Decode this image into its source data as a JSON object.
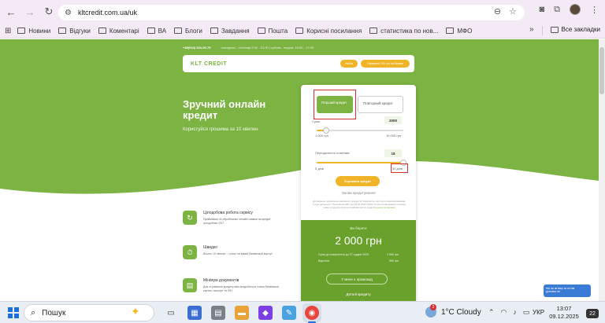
{
  "browser": {
    "url": "kltcredit.com.ua/uk",
    "nav_back": "←",
    "nav_forward": "→",
    "nav_reload": "↻",
    "zoom_icon": "⊖",
    "star_icon": "☆"
  },
  "bookmarks": {
    "apps_label": "⊞",
    "items": [
      "Новини",
      "Відгуки",
      "Коментарі",
      "ВА",
      "Блоги",
      "Завдання",
      "Пошта",
      "Корисні посилання",
      "статистика по нов...",
      "МФО"
    ],
    "more": "»",
    "all_bookmarks": "Все закладки"
  },
  "site": {
    "phone": "+38(044) 334-90-75",
    "hours": "понеділок - п'ятниця 9:00 - 21:00 | субота - неділя: 10:00 - 17:00",
    "logo": "KLT CREDIT",
    "btn_login": "Увійти",
    "btn_get": "Отримати 100 грн на баланс",
    "headline": "Зручний онлайн кредит",
    "subheadline": "Користуйся грошима за 10 хвилин",
    "features": [
      {
        "title": "Цілодобова робота сервісу",
        "text": "Приймаємо та обробляємо онлайн-заявки на кредит цілодобово 24/7",
        "icon": "↻"
      },
      {
        "title": "Швидко",
        "text": "Всього 10 хвилин - і гроші на вашій банківській картці!",
        "icon": "⏱"
      },
      {
        "title": "Мінімум документів",
        "text": "Для отримання кредиту вам знадобиться тільки банківська картка, паспорт та ІПН",
        "icon": "▤"
      }
    ]
  },
  "calculator": {
    "tab_first": "Перший кредит",
    "tab_repeat": "Повторний кредит",
    "amount_label": "Сума",
    "amount_value": "2000",
    "amount_min": "1 000 грн",
    "amount_max": "10 000 грн",
    "amount_level": 0.11,
    "term_label": "Періодичність платежів",
    "term_value": "18",
    "term_min": "5 днів",
    "term_max": "30 днів",
    "term_level": 1.0,
    "get_button": "Отримати кредит",
    "terms_link": "Умови кредитування",
    "note": "Договірною перевіркою заявлених продуктів Товариства, які стали інформативними, в ході діяльності. Посилання НБУ від 15.10.2021 №153 та іншої інформації стосовно зміни продуктів можна ознайомитися в розділі",
    "note_link": "Корисні посилання",
    "you_return": "Ви берете",
    "sum": "2 000 грн",
    "rows": [
      {
        "label": "Сума до повернення до 27 грудня 2025",
        "value": "2 568 грн"
      },
      {
        "label": "Відсотки",
        "value": "568 грн"
      }
    ],
    "promo": "У мене є промокод",
    "details": "Деталі кредиту"
  },
  "chat": "Ми на зв'язку та готові допомогти!",
  "taskbar": {
    "search": "Пошук",
    "weather_badge": "2",
    "weather": "1°C  Cloudy",
    "lang": "УКР",
    "time": "13:07",
    "date": "09.12.2025",
    "notifications": "22"
  },
  "colors": {
    "brand_green": "#7cb342",
    "accent_yellow": "#f0b429",
    "highlight_red": "#d32f2f"
  }
}
